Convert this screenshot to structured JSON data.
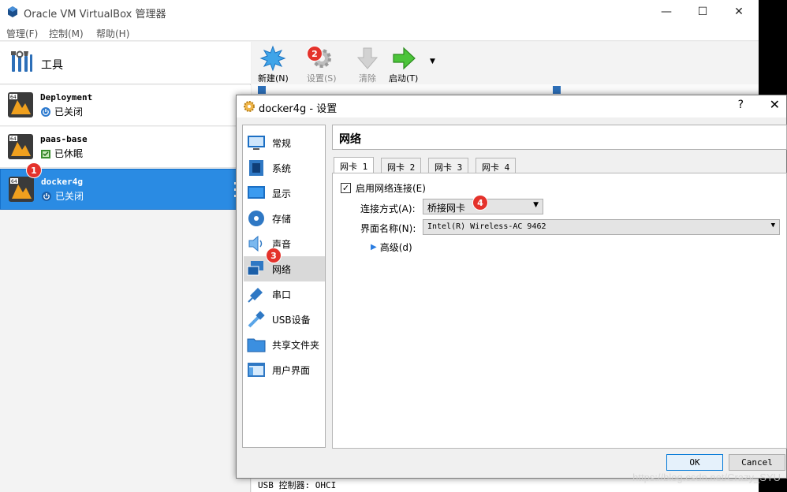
{
  "window": {
    "title": "Oracle VM VirtualBox 管理器"
  },
  "menu": [
    "管理(F)",
    "控制(M)",
    "帮助(H)"
  ],
  "tools": {
    "label": "工具"
  },
  "vms": [
    {
      "name": "Deployment",
      "status": "已关闭",
      "status_icon": "power-icon"
    },
    {
      "name": "paas-base",
      "status": "已休眠",
      "status_icon": "saved-state-icon"
    },
    {
      "name": "docker4g",
      "status": "已关闭",
      "status_icon": "power-icon",
      "selected": true
    }
  ],
  "toolbar": {
    "new": "新建(N)",
    "settings": "设置(S)",
    "discard": "清除",
    "start": "启动(T)"
  },
  "details": {
    "usb_line": "USB 控制器:   OHCI"
  },
  "dialog": {
    "title": "docker4g - 设置",
    "help": "?",
    "categories": [
      "常规",
      "系统",
      "显示",
      "存储",
      "声音",
      "网络",
      "串口",
      "USB设备",
      "共享文件夹",
      "用户界面"
    ],
    "selected_category": "网络",
    "page_title": "网络",
    "tabs": [
      "网卡 1",
      "网卡 2",
      "网卡 3",
      "网卡 4"
    ],
    "enable_adapter": {
      "label": "启用网络连接(E)",
      "checked": true
    },
    "attached_to": {
      "label": "连接方式(A):",
      "value": "桥接网卡"
    },
    "name_field": {
      "label": "界面名称(N):",
      "value": "Intel(R) Wireless-AC 9462"
    },
    "advanced": "高级(d)",
    "ok": "OK",
    "cancel": "Cancel"
  },
  "badges": [
    "1",
    "2",
    "3",
    "4"
  ],
  "watermark": "https://blog.csdn.net/Crazy_SYU",
  "colors": {
    "selection": "#2a8be3",
    "badge": "#e4322b"
  }
}
